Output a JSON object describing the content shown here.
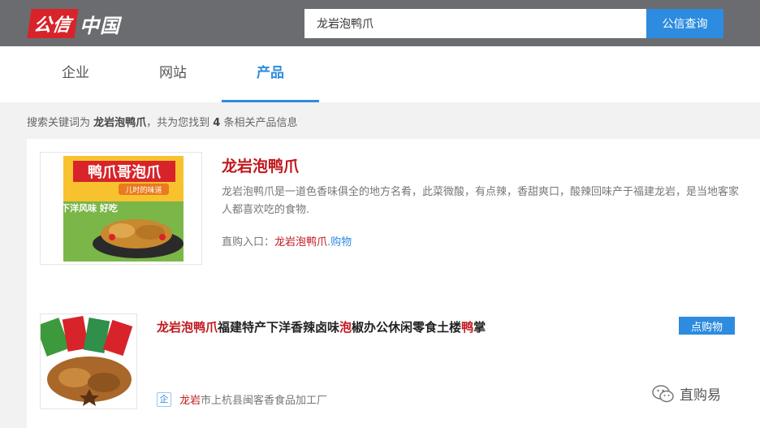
{
  "header": {
    "logo_red": "公信",
    "logo_white": "中国",
    "search_value": "龙岩泡鸭爪",
    "search_button": "公信查询"
  },
  "tabs": [
    {
      "label": "企业"
    },
    {
      "label": "网站"
    },
    {
      "label": "产品",
      "active": true
    }
  ],
  "summary": {
    "prefix": "搜索关键词为 ",
    "keyword": "龙岩泡鸭爪",
    "middle": "，共为您找到 ",
    "count": "4",
    "suffix": " 条相关产品信息"
  },
  "results": [
    {
      "title": "龙岩泡鸭爪",
      "image_texts": {
        "banner": "鸭爪哥泡爪",
        "ribbon": "儿时的味道",
        "badge": "下洋风味 好吃"
      },
      "description": "龙岩泡鸭爪是一道色香味俱全的地方名肴，此菜微酸，有点辣，香甜爽口，酸辣回味产于福建龙岩，是当地客家人都喜欢吃的食物.",
      "buy_label": "直购入口：",
      "buy_link_red": "龙岩泡鸭爪",
      "buy_link_blue": ".购物"
    },
    {
      "title_parts": [
        {
          "text": "龙岩泡鸭爪",
          "hl": true
        },
        {
          "text": "福建特产下洋香辣卤味",
          "hl": false
        },
        {
          "text": "泡",
          "hl": true
        },
        {
          "text": "椒办公休闲零食土楼",
          "hl": false
        },
        {
          "text": "鸭",
          "hl": true
        },
        {
          "text": "掌",
          "hl": false
        }
      ],
      "button": "点购物",
      "company_icon": "企",
      "company_red": "龙岩",
      "company_rest": "市上杭县闽客香食品加工厂"
    }
  ],
  "watermark": {
    "text": "直购易",
    "icon": "wechat-icon"
  }
}
